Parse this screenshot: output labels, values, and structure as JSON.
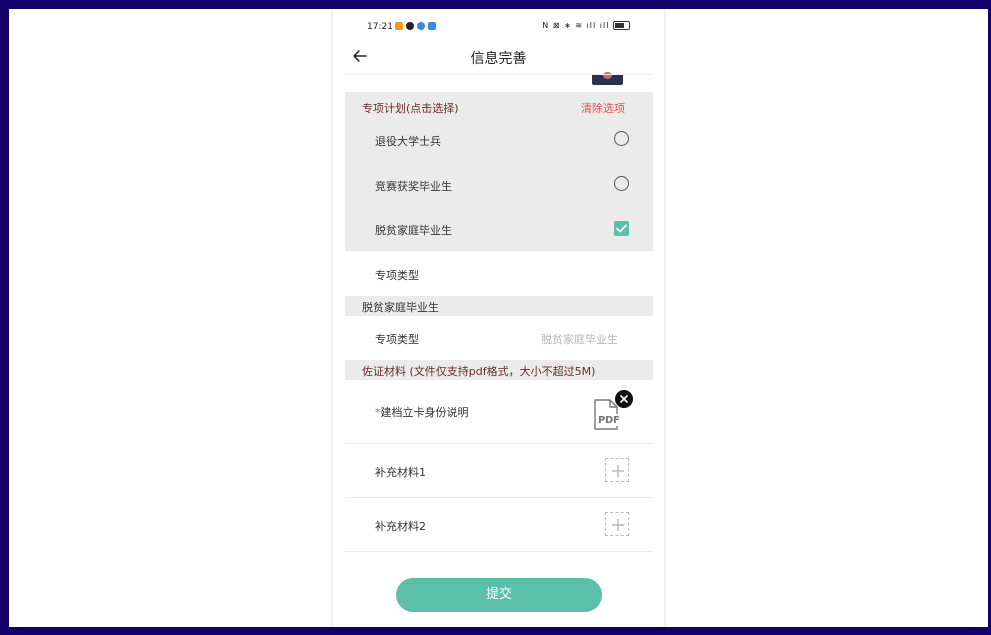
{
  "status_bar": {
    "time": "17:21",
    "app_icons": [
      {
        "icon": "mail-notification-icon",
        "color": "#f39a1e"
      },
      {
        "icon": "qq-icon",
        "color": "#222222"
      },
      {
        "icon": "app-notification-icon",
        "color": "#3a8be0"
      },
      {
        "icon": "message-notification-icon",
        "color": "#3a8be0"
      }
    ],
    "system_icons": "N ⊠ ∗ ≋ ıll ıll",
    "battery_label": "battery-icon"
  },
  "header": {
    "title": "信息完善",
    "back_icon": "back-arrow-icon"
  },
  "special_plan": {
    "heading": "专项计划(点击选择)",
    "clear_label": "清除选项",
    "options": [
      {
        "label": "退役大学士兵",
        "selected": false
      },
      {
        "label": "竞赛获奖毕业生",
        "selected": false
      },
      {
        "label": "脱贫家庭毕业生",
        "selected": true
      }
    ]
  },
  "special_type_row": {
    "label": "专项类型"
  },
  "poverty_section": {
    "heading": "脱贫家庭毕业生",
    "type_label": "专项类型",
    "type_value": "脱贫家庭毕业生"
  },
  "materials": {
    "heading": "佐证材料 (文件仅支持pdf格式，大小不超过5M)",
    "required_mark": "*",
    "items": [
      {
        "label": "建档立卡身份说明",
        "required": true,
        "uploaded": true,
        "file_icon": "pdf-file-icon",
        "file_text": "PDF"
      },
      {
        "label": "补充材料1",
        "required": false,
        "uploaded": false
      },
      {
        "label": "补充材料2",
        "required": false,
        "uploaded": false
      }
    ]
  },
  "submit_label": "提交",
  "colors": {
    "accent": "#5cbfa9",
    "danger": "#e0524f",
    "section_bg": "#ebebeb",
    "outer_border": "#13006a"
  }
}
